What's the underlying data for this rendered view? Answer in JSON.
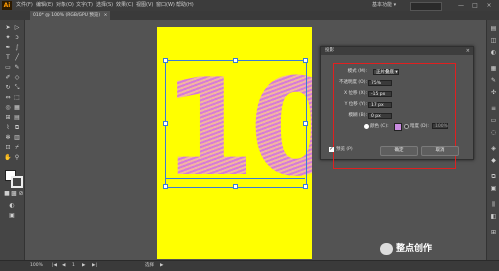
{
  "app": {
    "logo": "Ai",
    "workspace": "基本功能 ▾"
  },
  "menus": [
    "文件(F)",
    "编辑(E)",
    "对象(O)",
    "文字(T)",
    "选择(S)",
    "效果(C)",
    "视图(V)",
    "窗口(W)",
    "帮助(H)"
  ],
  "tab": {
    "label": "010* @ 100% (RGB/GPU 预览)",
    "close": "×"
  },
  "window_buttons": [
    "—",
    "□",
    "×"
  ],
  "dialog": {
    "title": "投影",
    "close": "×",
    "mode_label": "模式 (M):",
    "mode_value": "正片叠底",
    "opacity_label": "不透明度 (O):",
    "opacity_value": "75%",
    "x_label": "X 位移 (X):",
    "x_value": "-15 px",
    "y_label": "Y 位移 (Y):",
    "y_value": "17 px",
    "blur_label": "模糊 (B):",
    "blur_value": "0 px",
    "color_label": "颜色 (C):",
    "darkness_label": "暗度 (D):",
    "darkness_value": "100%",
    "color_swatch": "#c98be0",
    "preview_label": "预览 (P)",
    "ok_label": "确定",
    "cancel_label": "取消"
  },
  "artwork": {
    "text": "10",
    "artboard_color": "#ffff00"
  },
  "status": {
    "zoom": "100%",
    "page": "1",
    "tool": "选择"
  },
  "watermark": {
    "text": "整点创作"
  },
  "colors": {
    "accent_blue": "#3a7bd5",
    "highlight_red": "#e02020"
  }
}
